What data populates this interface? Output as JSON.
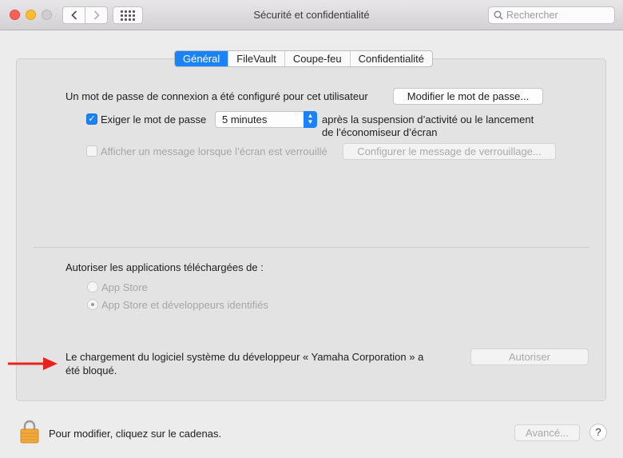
{
  "window": {
    "title": "Sécurité et confidentialité"
  },
  "search": {
    "placeholder": "Rechercher",
    "value": ""
  },
  "tabs": [
    {
      "label": "Général",
      "active": true
    },
    {
      "label": "FileVault",
      "active": false
    },
    {
      "label": "Coupe-feu",
      "active": false
    },
    {
      "label": "Confidentialité",
      "active": false
    }
  ],
  "general": {
    "password_text": "Un mot de passe de connexion a été configuré pour cet utilisateur",
    "change_password_button": "Modifier le mot de passe...",
    "require_password": {
      "label": "Exiger le mot de passe",
      "checked": true,
      "selected_value": "5 minutes",
      "suffix_line1": "après la suspension d’activité ou le lancement",
      "suffix_line2": "de l’économiseur d’écran"
    },
    "lock_message": {
      "label": "Afficher un message lorsque l’écran est verrouillé",
      "checked": false,
      "button": "Configurer le message de verrouillage..."
    },
    "apps_heading": "Autoriser les applications téléchargées de :",
    "radio_options": [
      {
        "label": "App Store",
        "selected": false
      },
      {
        "label": "App Store et développeurs identifiés",
        "selected": true
      }
    ],
    "blocked_line1": "Le chargement du logiciel système du développeur « Yamaha Corporation » a",
    "blocked_line2": "été bloqué.",
    "allow_button": "Autoriser"
  },
  "footer": {
    "lock_text": "Pour modifier, cliquez sur le cadenas.",
    "advanced_button": "Avancé...",
    "help_button": "?"
  },
  "colors": {
    "accent": "#1a82fb",
    "annotation_arrow": "#e8231f"
  }
}
